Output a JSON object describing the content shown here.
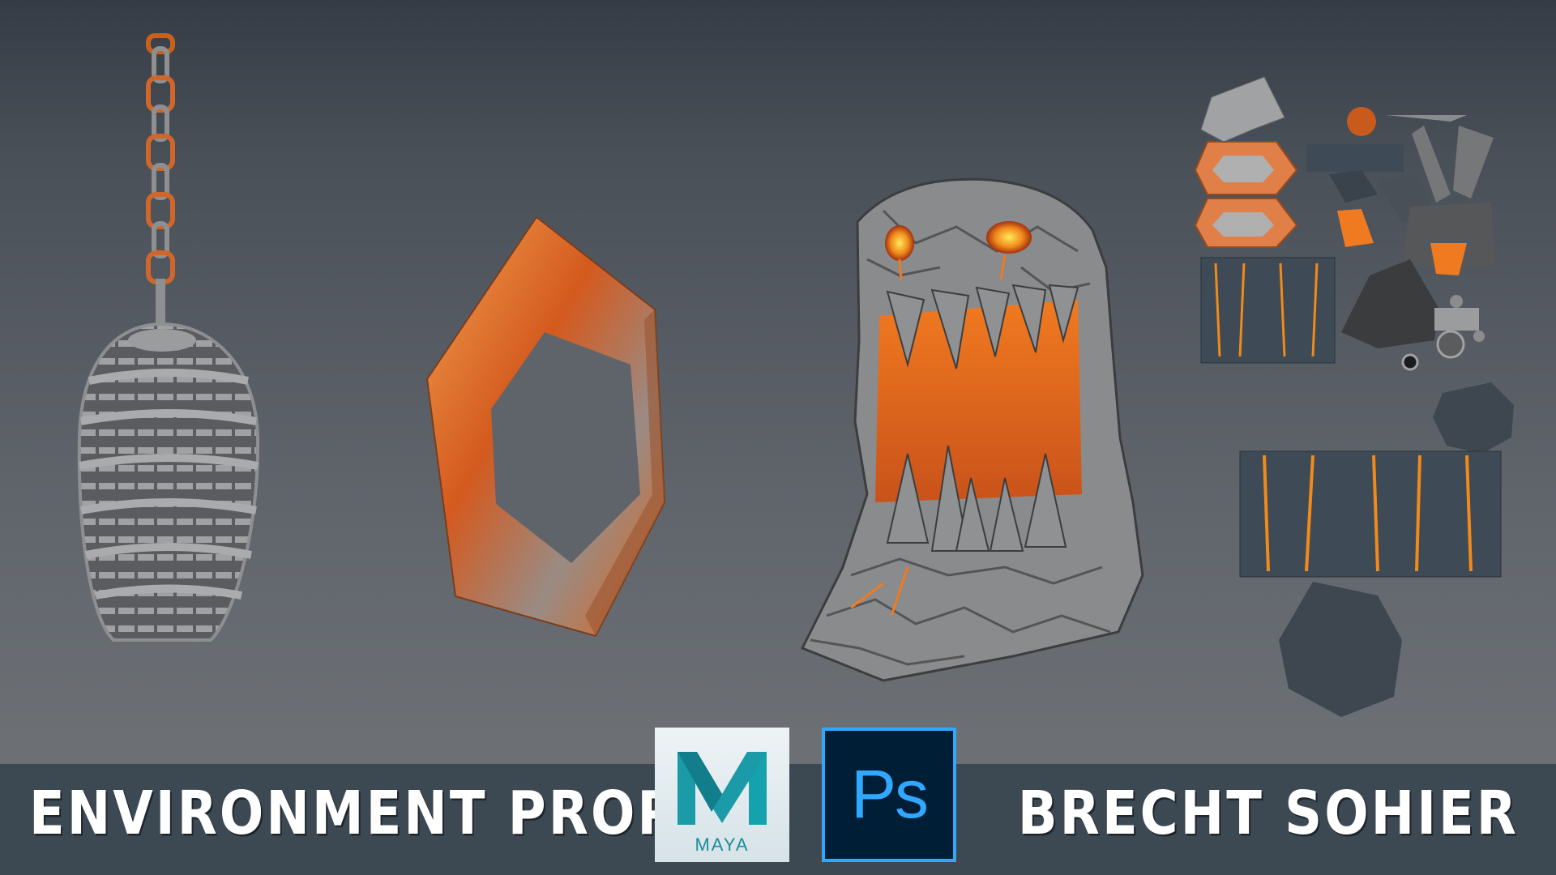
{
  "footer": {
    "title_left": "Environment Props",
    "title_right": "Brecht Sohier"
  },
  "logos": {
    "maya_label": "MAYA",
    "ps_label": "Ps"
  },
  "icons": [
    "maya-logo-icon",
    "photoshop-logo-icon"
  ],
  "colors": {
    "lava": "#e0641c",
    "stone": "#8a8c8e",
    "bar": "#3c4852",
    "maya": "#1b8d9a",
    "photoshop": "#31a8ff"
  }
}
